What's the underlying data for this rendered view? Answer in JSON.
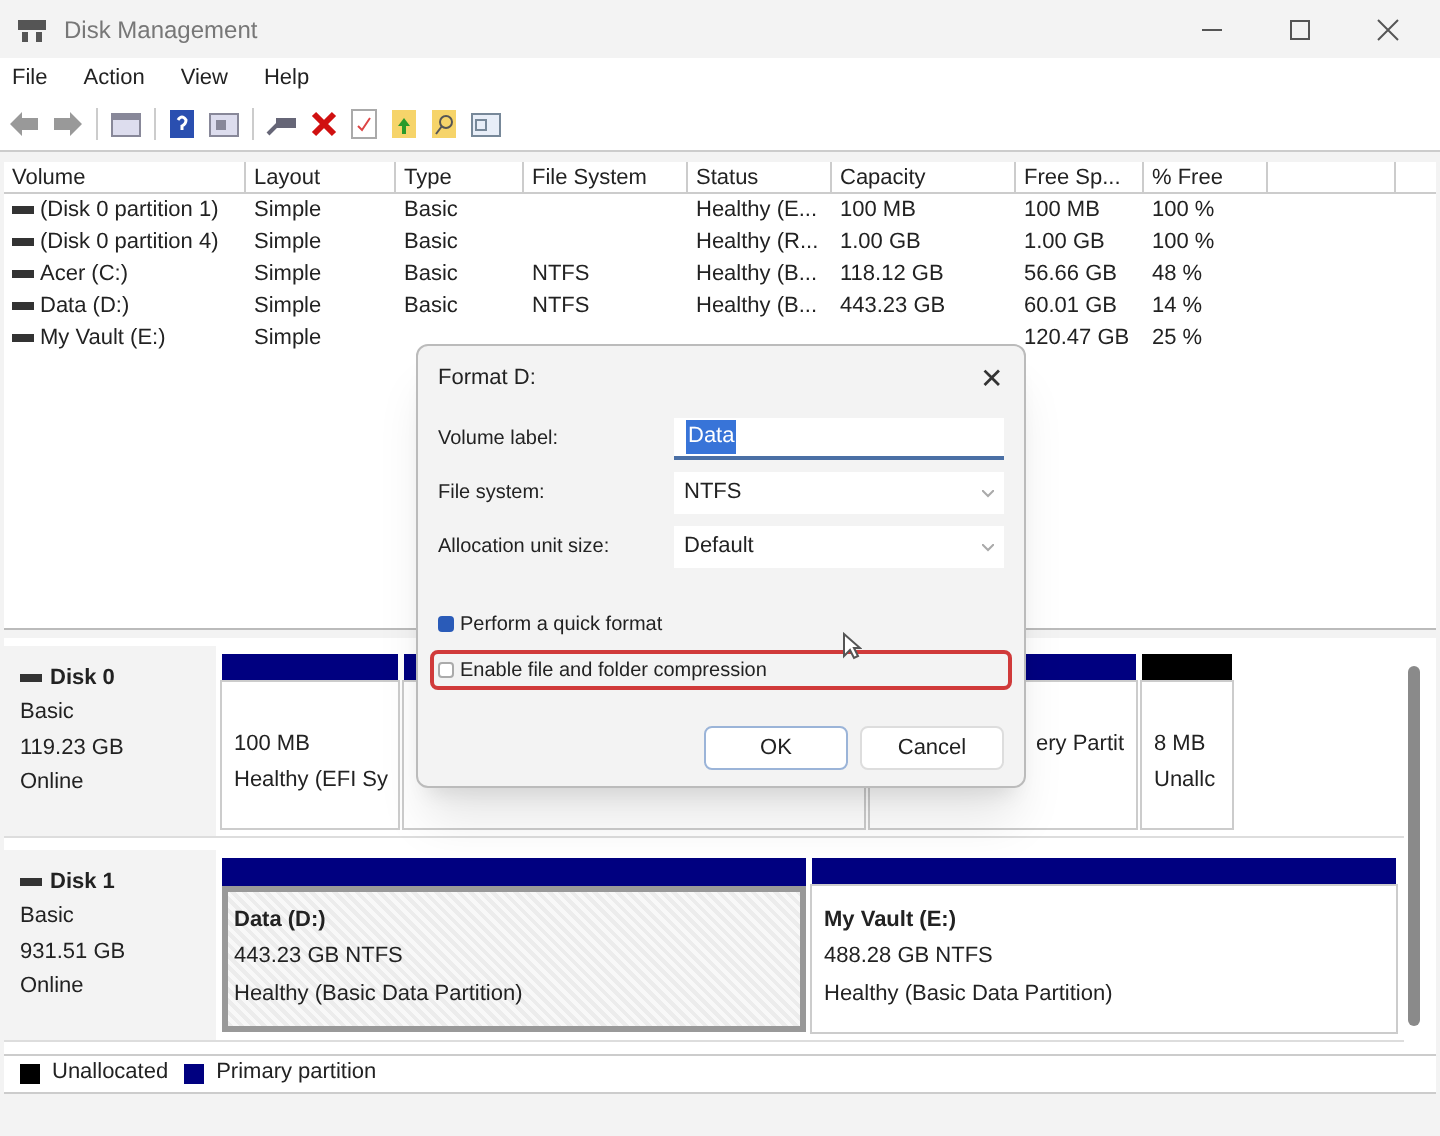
{
  "window": {
    "title": "Disk Management"
  },
  "menu": [
    "File",
    "Action",
    "View",
    "Help"
  ],
  "table": {
    "columns": [
      "Volume",
      "Layout",
      "Type",
      "File System",
      "Status",
      "Capacity",
      "Free Sp...",
      "% Free"
    ],
    "rows": [
      {
        "volume": "(Disk 0 partition 1)",
        "layout": "Simple",
        "type": "Basic",
        "status": "Healthy (E...",
        "capacity": "100 MB",
        "free_space": "100 MB",
        "percent_free": "100 %"
      },
      {
        "volume": "(Disk 0 partition 4)",
        "layout": "Simple",
        "type": "Basic",
        "status": "Healthy (R...",
        "capacity": "1.00 GB",
        "free_space": "1.00 GB",
        "percent_free": "100 %"
      },
      {
        "volume": "Acer (C:)",
        "layout": "Simple",
        "type": "Basic",
        "file_system": "NTFS",
        "status": "Healthy (B...",
        "capacity": "118.12 GB",
        "free_space": "56.66 GB",
        "percent_free": "48 %"
      },
      {
        "volume": "Data (D:)",
        "layout": "Simple",
        "type": "Basic",
        "file_system": "NTFS",
        "status": "Healthy (B...",
        "capacity": "443.23 GB",
        "free_space": "60.01 GB",
        "percent_free": "14 %"
      },
      {
        "volume": "My Vault (E:)",
        "layout": "Simple",
        "free_space": "120.47 GB",
        "percent_free": "25 %"
      }
    ]
  },
  "disks": [
    {
      "name": "Disk 0",
      "type": "Basic",
      "size": "119.23 GB",
      "state": "Online",
      "partitions": [
        {
          "kind": "primary",
          "selected": false,
          "lines": [
            "100 MB",
            "Healthy (EFI Sy"
          ]
        },
        {
          "kind": "primary",
          "selected": false
        },
        {
          "kind": "primary",
          "selected": false,
          "lines": [
            "ery Partit"
          ]
        },
        {
          "kind": "unallocated",
          "selected": false,
          "lines": [
            "8 MB",
            "Unallc"
          ]
        }
      ]
    },
    {
      "name": "Disk 1",
      "type": "Basic",
      "size": "931.51 GB",
      "state": "Online",
      "partitions": [
        {
          "kind": "primary",
          "selected": true,
          "title": "Data  (D:)",
          "lines": [
            "443.23 GB NTFS",
            "Healthy (Basic Data Partition)"
          ]
        },
        {
          "kind": "primary",
          "selected": false,
          "title": "My Vault  (E:)",
          "lines": [
            "488.28 GB NTFS",
            "Healthy (Basic Data Partition)"
          ]
        }
      ]
    }
  ],
  "legend": [
    {
      "label": "Unallocated",
      "color": "#000000"
    },
    {
      "label": "Primary partition",
      "color": "#000080"
    }
  ],
  "dialog": {
    "title": "Format D:",
    "close": "✕",
    "fields": [
      {
        "kind": "text",
        "label": "Volume label:",
        "value": "Data"
      },
      {
        "kind": "select",
        "label": "File system:",
        "value": "NTFS"
      },
      {
        "kind": "select",
        "label": "Allocation unit size:",
        "value": "Default"
      }
    ],
    "checkboxes": [
      {
        "label": "Perform a quick format",
        "checked": true,
        "highlighted": false
      },
      {
        "label": "Enable file and folder compression",
        "checked": false,
        "highlighted": true
      }
    ],
    "buttons": [
      {
        "label": "OK",
        "default": true
      },
      {
        "label": "Cancel",
        "default": false
      }
    ]
  }
}
